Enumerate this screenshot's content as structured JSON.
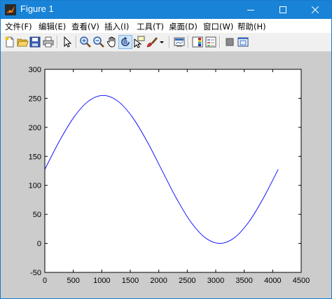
{
  "window": {
    "title": "Figure 1",
    "accent_color": "#1883d7"
  },
  "menu": {
    "items": [
      {
        "label": "文件(F)"
      },
      {
        "label": "编辑(E)"
      },
      {
        "label": "查看(V)"
      },
      {
        "label": "插入(I)"
      },
      {
        "label": "工具(T)"
      },
      {
        "label": "桌面(D)"
      },
      {
        "label": "窗口(W)"
      },
      {
        "label": "帮助(H)"
      }
    ]
  },
  "toolbar": {
    "icons": [
      "new-figure-icon",
      "open-file-icon",
      "save-icon",
      "print-icon",
      "edit-plot-arrow-icon",
      "zoom-in-icon",
      "zoom-out-icon",
      "pan-hand-icon",
      "rotate-3d-icon",
      "data-cursor-icon",
      "brush-icon",
      "brush-dropdown-icon",
      "link-plot-icon",
      "insert-colorbar-icon",
      "insert-legend-icon",
      "hide-plot-tools-icon",
      "show-plot-tools-icon"
    ]
  },
  "chart_data": {
    "type": "line",
    "title": "",
    "xlabel": "",
    "ylabel": "",
    "xlim": [
      0,
      4500
    ],
    "ylim": [
      -50,
      300
    ],
    "xticks": [
      0,
      500,
      1000,
      1500,
      2000,
      2500,
      3000,
      3500,
      4000,
      4500
    ],
    "yticks": [
      -50,
      0,
      50,
      100,
      150,
      200,
      250,
      300
    ],
    "grid": false,
    "series": [
      {
        "color": "#0000ff",
        "x": [
          0,
          256,
          512,
          768,
          1024,
          1280,
          1536,
          1792,
          2048,
          2304,
          2560,
          2816,
          3072,
          3328,
          3584,
          3840,
          4096
        ],
        "y": [
          127.5,
          176.3,
          217.7,
          245.3,
          255,
          245.3,
          217.7,
          176.3,
          127.5,
          78.7,
          37.3,
          9.7,
          0,
          9.7,
          37.3,
          78.7,
          127.5
        ]
      }
    ]
  }
}
